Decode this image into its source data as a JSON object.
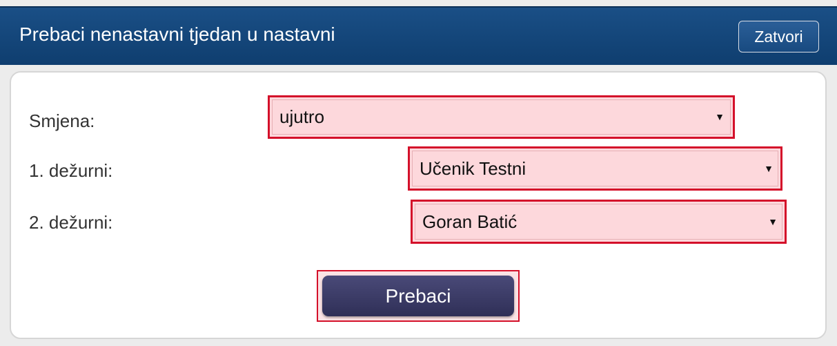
{
  "dialog": {
    "title": "Prebaci nenastavni tjedan u nastavni",
    "close_label": "Zatvori"
  },
  "form": {
    "shift": {
      "label": "Smjena:",
      "value": "ujutro"
    },
    "duty1": {
      "label": "1. dežurni:",
      "value": "Učenik Testni"
    },
    "duty2": {
      "label": "2. dežurni:",
      "value": "Goran Batić"
    },
    "dropdown_arrow": "▼",
    "submit_label": "Prebaci"
  },
  "colors": {
    "titlebar": "#0f3e6f",
    "error_border": "#d4102a",
    "error_fill": "#fdd8dc",
    "submit_button": "#3a3a66"
  }
}
